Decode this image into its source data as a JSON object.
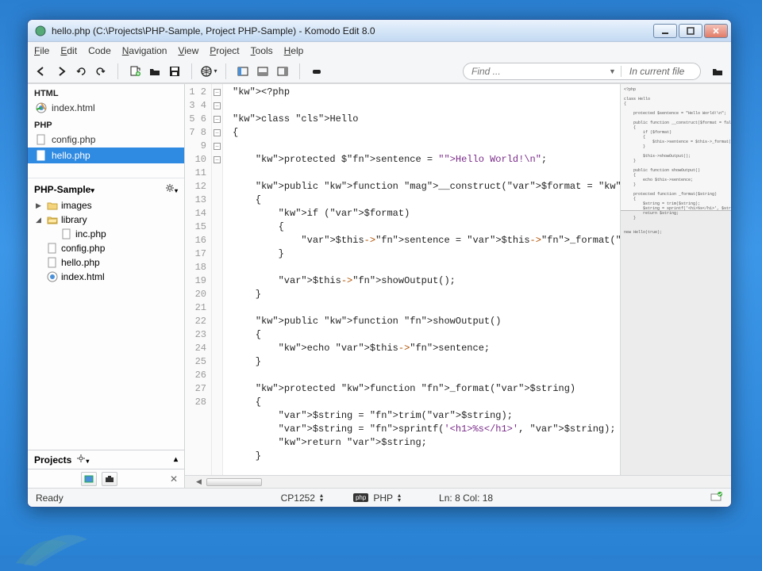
{
  "window": {
    "title": "hello.php (C:\\Projects\\PHP-Sample, Project PHP-Sample) - Komodo Edit 8.0"
  },
  "menu": {
    "file": "File",
    "edit": "Edit",
    "code": "Code",
    "navigation": "Navigation",
    "view": "View",
    "project": "Project",
    "tools": "Tools",
    "help": "Help"
  },
  "find": {
    "placeholder": "Find ...",
    "scope": "In current file"
  },
  "openFiles": {
    "group1": "HTML",
    "item1": "index.html",
    "group2": "PHP",
    "item2": "config.php",
    "item3": "hello.php"
  },
  "projectPanel": {
    "name": "PHP-Sample",
    "tree": {
      "images": "images",
      "library": "library",
      "inc": "inc.php",
      "config": "config.php",
      "hello": "hello.php",
      "index": "index.html"
    },
    "stripLabel": "Projects"
  },
  "editor": {
    "lines": [
      "<?php",
      "",
      "class Hello",
      "{",
      "",
      "    protected $sentence = \"Hello World!\\n\";",
      "",
      "    public function __construct($format = false)",
      "    {",
      "        if ($format)",
      "        {",
      "            $this->sentence = $this->_format($this->",
      "        }",
      "",
      "        $this->showOutput();",
      "    }",
      "",
      "    public function showOutput()",
      "    {",
      "        echo $this->sentence;",
      "    }",
      "",
      "    protected function _format($string)",
      "    {",
      "        $string = trim($string);",
      "        $string = sprintf('<h1>%s</h1>', $string);",
      "        return $string;",
      "    }"
    ]
  },
  "status": {
    "ready": "Ready",
    "encoding": "CP1252",
    "langLabel": "PHP",
    "langBadge": "php",
    "position": "Ln: 8 Col: 18"
  }
}
